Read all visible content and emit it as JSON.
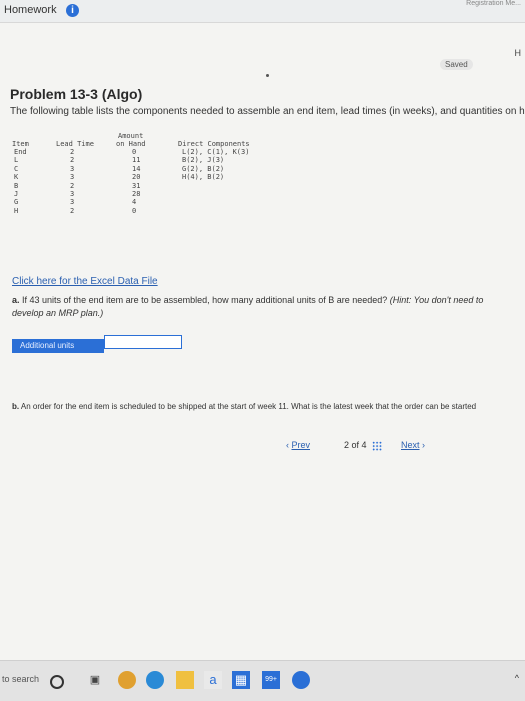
{
  "header": {
    "title": "Homework",
    "info_icon_glyph": "i",
    "right_text": "Registration Me..."
  },
  "status": {
    "saved_label": "Saved",
    "side_letter": "H"
  },
  "problem": {
    "title": "Problem 13-3 (Algo)",
    "intro": "The following table lists the components needed to assemble an end item, lead times (in weeks), and quantities on hand."
  },
  "table": {
    "headers": {
      "item": "Item",
      "lead_time": "Lead Time",
      "amount_line1": "Amount",
      "amount_line2": "on Hand",
      "direct": "Direct Components"
    },
    "rows": [
      {
        "item": "End",
        "lead": "2",
        "amount": "0",
        "direct": "L(2), C(1), K(3)"
      },
      {
        "item": "L",
        "lead": "2",
        "amount": "11",
        "direct": "B(2), J(3)"
      },
      {
        "item": "C",
        "lead": "3",
        "amount": "14",
        "direct": "G(2), B(2)"
      },
      {
        "item": "K",
        "lead": "3",
        "amount": "20",
        "direct": "H(4), B(2)"
      },
      {
        "item": "B",
        "lead": "2",
        "amount": "31",
        "direct": ""
      },
      {
        "item": "J",
        "lead": "3",
        "amount": "28",
        "direct": ""
      },
      {
        "item": "G",
        "lead": "3",
        "amount": "4",
        "direct": ""
      },
      {
        "item": "H",
        "lead": "2",
        "amount": "0",
        "direct": ""
      }
    ]
  },
  "excel_link": "Click here for the Excel Data File",
  "question_a": {
    "label": "a.",
    "text": "If 43 units of the end item are to be assembled, how many additional units of B are needed?",
    "hint": "(Hint: You don't need to develop an MRP plan.)"
  },
  "answer_input": {
    "label": "Additional units",
    "value": ""
  },
  "question_b": {
    "label": "b.",
    "text": "An order for the end item is scheduled to be shipped at the start of week 11. What is the latest week that the order can be started"
  },
  "pagination": {
    "prev_label": "Prev",
    "page_text": "2 of 4",
    "next_label": "Next"
  },
  "taskbar": {
    "search_text": "to search",
    "badge": "99+"
  },
  "colors": {
    "accent": "#2b6fd6",
    "link": "#2a5fb0"
  }
}
